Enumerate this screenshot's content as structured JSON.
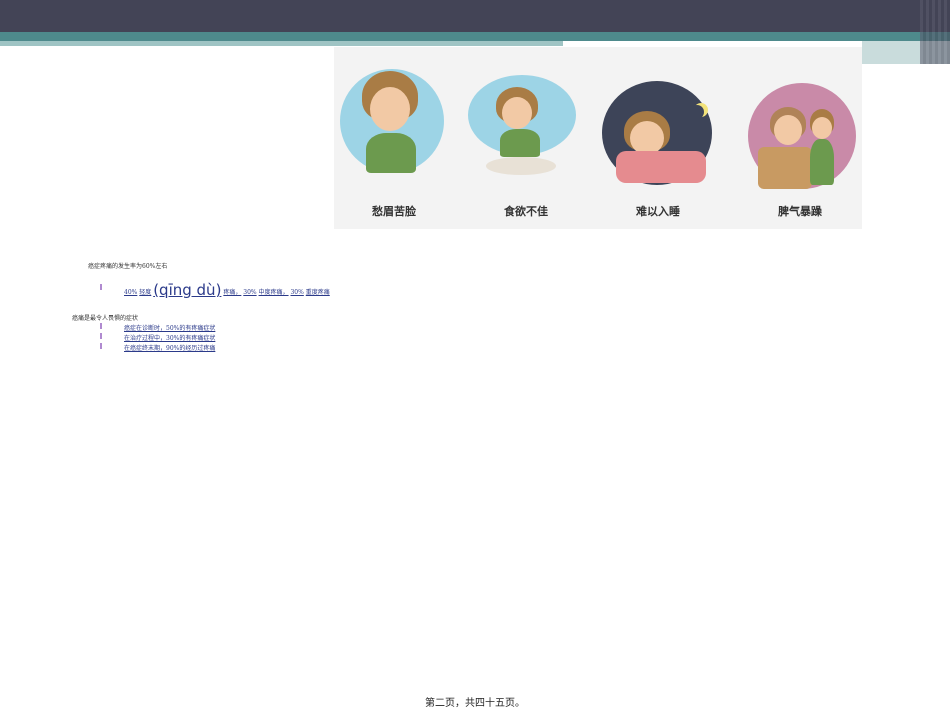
{
  "illustration": {
    "captions": [
      "愁眉苦脸",
      "食欲不佳",
      "难以入睡",
      "脾气暴躁"
    ]
  },
  "text": {
    "line1": "癌症疼痛的发生率为60%左右",
    "line2_a": "40%",
    "line2_b": "轻度",
    "line2_pinyin": "(qīng dù)",
    "line2_c": "疼痛，",
    "line2_d": "30%",
    "line2_e": "中度疼痛，",
    "line2_f": "30%",
    "line2_g": "重度疼痛",
    "line3": "癌痛是最令人畏惧的症状",
    "bullets": [
      "癌症在诊断时，50%的有疼痛症状",
      "在治疗过程中，30%的有疼痛症状",
      "在癌症终末期，90%的经历过疼痛"
    ]
  },
  "footer": "第二页，共四十五页。",
  "colors": {
    "header": "#434456",
    "teal": "#4e8a8c",
    "light_teal": "#9fc4c4"
  }
}
